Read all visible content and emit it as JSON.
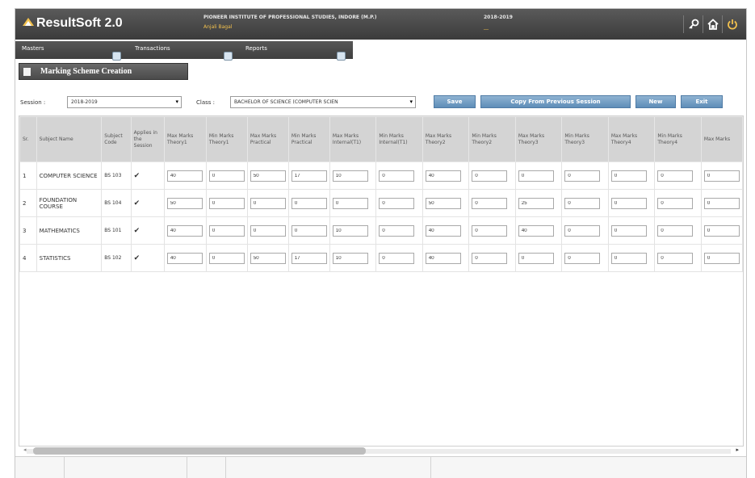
{
  "header": {
    "app_name": "ResultSoft 2.0",
    "institute": "PIONEER INSTITUTE OF PROFESSIONAL STUDIES, INDORE (M.P.)",
    "user": "Anjali Bagal",
    "session": "2018-2019",
    "session_sub": "__",
    "icons": [
      "key-icon",
      "home-icon",
      "power-icon"
    ]
  },
  "menu": {
    "items": [
      "Masters",
      "Transactions",
      "Reports"
    ]
  },
  "page_title": "Marking Scheme Creation",
  "filters": {
    "session_label": "Session :",
    "session_value": "2018-2019",
    "class_label": "Class :",
    "class_value": "BACHELOR OF SCIENCE (COMPUTER SCIEN"
  },
  "buttons": {
    "save": "Save",
    "copy": "Copy From Previous Session",
    "new": "New",
    "exit": "Exit"
  },
  "table": {
    "columns": [
      "Sr.",
      "Subject Name",
      "Subject Code",
      "Applies in the Session",
      "Max Marks Theory1",
      "Min Marks Theory1",
      "Max Marks Practical",
      "Min Marks Practical",
      "Max Marks Internal(T1)",
      "Min Marks Internal(T1)",
      "Max Marks Theory2",
      "Min Marks Theory2",
      "Max Marks Theory3",
      "Min Marks Theory3",
      "Max Marks Theory4",
      "Min Marks Theory4",
      "Max Marks"
    ],
    "rows": [
      {
        "sr": "1",
        "name": "COMPUTER SCIENCE",
        "code": "BS 103",
        "checked": "✔",
        "v": [
          "40",
          "0",
          "50",
          "17",
          "10",
          "0",
          "40",
          "0",
          "0",
          "0",
          "0",
          "0",
          "0"
        ]
      },
      {
        "sr": "2",
        "name": "FOUNDATION COURSE",
        "code": "BS 104",
        "checked": "✔",
        "v": [
          "50",
          "0",
          "0",
          "0",
          "0",
          "0",
          "50",
          "0",
          "25",
          "0",
          "0",
          "0",
          "0"
        ]
      },
      {
        "sr": "3",
        "name": "MATHEMATICS",
        "code": "BS 101",
        "checked": "✔",
        "v": [
          "40",
          "0",
          "0",
          "0",
          "10",
          "0",
          "40",
          "0",
          "40",
          "0",
          "0",
          "0",
          "0"
        ]
      },
      {
        "sr": "4",
        "name": "STATISTICS",
        "code": "BS 102",
        "checked": "✔",
        "v": [
          "40",
          "0",
          "50",
          "17",
          "10",
          "0",
          "40",
          "0",
          "0",
          "0",
          "0",
          "0",
          "0"
        ]
      }
    ]
  },
  "colors": {
    "header_bg": "#3b3b3b",
    "accent_button": "#5e8db8",
    "user_text": "#f2c14e"
  }
}
